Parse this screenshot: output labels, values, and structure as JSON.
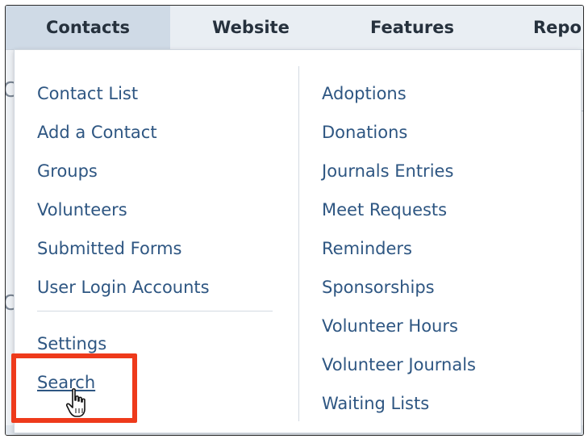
{
  "nav": {
    "tabs": [
      {
        "label": "Contacts",
        "active": true
      },
      {
        "label": "Website",
        "active": false
      },
      {
        "label": "Features",
        "active": false
      },
      {
        "label": "Repo",
        "active": false
      }
    ]
  },
  "dropdown": {
    "left_column": [
      "Contact List",
      "Add a Contact",
      "Groups",
      "Volunteers",
      "Submitted Forms",
      "User Login Accounts"
    ],
    "left_column_lower": [
      "Settings",
      "Search"
    ],
    "right_column": [
      "Adoptions",
      "Donations",
      "Journals Entries",
      "Meet Requests",
      "Reminders",
      "Sponsorships",
      "Volunteer Hours",
      "Volunteer Journals",
      "Waiting Lists"
    ]
  },
  "colors": {
    "link": "#2e5682",
    "highlight": "#ee3a1b",
    "active_tab": "#cfdae6"
  },
  "icons": {
    "cursor": "hand-pointer-icon"
  }
}
